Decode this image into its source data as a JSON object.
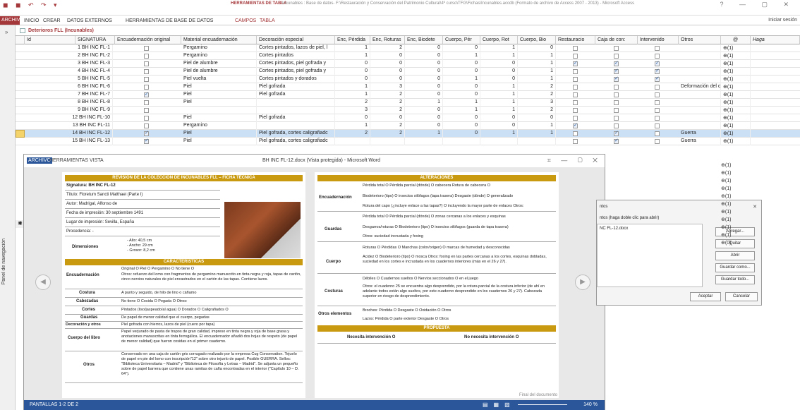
{
  "app": {
    "qat": "◼ ◼ ↶ ↷ ▾",
    "context_label": "HERRAMIENTAS DE TABLA",
    "title": "Incunables : Base de datos- F:\\Restauración y Conservación del Patrimonio Cultural\\4º curso\\TFG\\Fichas\\Incunables.accdb (Formato de archivo de Access 2007 - 2013) - Microsoft Access",
    "window_controls": "? — ▢ ✕",
    "signin": "Iniciar sesión"
  },
  "ribbon": {
    "archivo": "ARCHIVO",
    "tabs": [
      "INICIO",
      "CREAR",
      "DATOS EXTERNOS",
      "HERRAMIENTAS DE BASE DE DATOS",
      "CAMPOS",
      "TABLA"
    ]
  },
  "nav": {
    "label": "Panel de navegación",
    "toggle": "»"
  },
  "table": {
    "tab_label": "Deterioros FLL (Incunables)",
    "columns": [
      "Id",
      "SIGNATURA",
      "Encuadernación original",
      "Material encuadernación",
      "Decoración especial",
      "Enc, Pérdida",
      "Enc, Roturas",
      "Enc, Biodete",
      "Cuerpo, Pér",
      "Cuerpo, Rot",
      "Cuerpo, Bio",
      "Restauracio",
      "Caja de con:",
      "Intervenido",
      "Otros",
      "@",
      "Haga"
    ],
    "rows": [
      {
        "sig": "1 BH INC FL-1",
        "orig": false,
        "mat": "Pergamino",
        "dec": "Cortes pintados, lazos de piel, l",
        "ep": "1",
        "er": "2",
        "eb": "0",
        "cp": "0",
        "cr": "1",
        "cb": "0",
        "rest": false,
        "caja": false,
        "int": false,
        "otros": "",
        "att": "(1)"
      },
      {
        "sig": "2 BH INC FL-2",
        "orig": false,
        "mat": "Pergamino",
        "dec": "Cortes pintados",
        "ep": "1",
        "er": "0",
        "eb": "0",
        "cp": "1",
        "cr": "1",
        "cb": "1",
        "rest": false,
        "caja": false,
        "int": false,
        "otros": "",
        "att": "(1)"
      },
      {
        "sig": "3 BH INC FL-3",
        "orig": false,
        "mat": "Piel de alumbre",
        "dec": "Cortes pintados, piel gofrada y",
        "ep": "0",
        "er": "0",
        "eb": "0",
        "cp": "0",
        "cr": "0",
        "cb": "1",
        "rest": true,
        "caja": true,
        "int": true,
        "otros": "",
        "att": "(1)"
      },
      {
        "sig": "4 BH INC FL-4",
        "orig": false,
        "mat": "Piel de alumbre",
        "dec": "Cortes pintados, piel gofrada y",
        "ep": "0",
        "er": "0",
        "eb": "0",
        "cp": "0",
        "cr": "0",
        "cb": "1",
        "rest": false,
        "caja": true,
        "int": true,
        "otros": "",
        "att": "(1)"
      },
      {
        "sig": "5 BH INC FL-5",
        "orig": false,
        "mat": "Piel vuelta",
        "dec": "Cortes pintados y dorados",
        "ep": "0",
        "er": "0",
        "eb": "0",
        "cp": "1",
        "cr": "0",
        "cb": "1",
        "rest": false,
        "caja": true,
        "int": true,
        "otros": "",
        "att": "(1)"
      },
      {
        "sig": "6 BH INC FL-6",
        "orig": false,
        "mat": "Piel",
        "dec": "Piel gofrada",
        "ep": "1",
        "er": "3",
        "eb": "0",
        "cp": "0",
        "cr": "1",
        "cb": "2",
        "rest": false,
        "caja": false,
        "int": false,
        "otros": "Deformación del cu",
        "att": "(1)"
      },
      {
        "sig": "7 BH INC FL-7",
        "orig": true,
        "mat": "Piel",
        "dec": "Piel gofrada",
        "ep": "1",
        "er": "2",
        "eb": "0",
        "cp": "0",
        "cr": "1",
        "cb": "2",
        "rest": false,
        "caja": false,
        "int": false,
        "otros": "",
        "att": "(1)"
      },
      {
        "sig": "8 BH INC FL-8",
        "orig": false,
        "mat": "Piel",
        "dec": "",
        "ep": "2",
        "er": "2",
        "eb": "1",
        "cp": "1",
        "cr": "1",
        "cb": "3",
        "rest": false,
        "caja": false,
        "int": false,
        "otros": "",
        "att": "(1)"
      },
      {
        "sig": "9 BH INC FL-9",
        "orig": false,
        "mat": "",
        "dec": "",
        "ep": "3",
        "er": "2",
        "eb": "0",
        "cp": "1",
        "cr": "1",
        "cb": "2",
        "rest": false,
        "caja": false,
        "int": false,
        "otros": "",
        "att": "(1)"
      },
      {
        "sig": "12 BH INC FL-10",
        "orig": false,
        "mat": "Piel",
        "dec": "Piel gofrada",
        "ep": "0",
        "er": "0",
        "eb": "0",
        "cp": "0",
        "cr": "0",
        "cb": "0",
        "rest": false,
        "caja": false,
        "int": false,
        "otros": "",
        "att": "(1)"
      },
      {
        "sig": "13 BH INC FL-11",
        "orig": false,
        "mat": "Pergamino",
        "dec": "",
        "ep": "1",
        "er": "2",
        "eb": "0",
        "cp": "0",
        "cr": "0",
        "cb": "1",
        "rest": true,
        "caja": false,
        "int": false,
        "otros": "",
        "att": "(1)"
      },
      {
        "sig": "14 BH INC FL-12",
        "orig": true,
        "mat": "Piel",
        "dec": "Piel gofrada, cortes caligrafiadc",
        "ep": "2",
        "er": "2",
        "eb": "1",
        "cp": "0",
        "cr": "1",
        "cb": "1",
        "rest": false,
        "caja": true,
        "int": false,
        "otros": "Guerra",
        "att": "(1)"
      },
      {
        "sig": "15 BH INC FL-13",
        "orig": true,
        "mat": "Piel",
        "dec": "Piel gofrada, cortes caligrafiadc",
        "ep": "",
        "er": "",
        "eb": "",
        "cp": "",
        "cr": "",
        "cb": "",
        "rest": false,
        "caja": true,
        "int": false,
        "otros": "Guerra",
        "att": "(1)"
      }
    ],
    "extra_att": [
      "(1)",
      "(1)",
      "(1)",
      "(1)",
      "(1)",
      "(1)",
      "(1)",
      "(1)",
      "(1)",
      "(1)",
      "(0)"
    ]
  },
  "word": {
    "tabs": [
      "ARCHIVO",
      "HERRAMIENTAS",
      "VISTA"
    ],
    "title": "BH INC FL-12.docx (Vista protegida) - Microsoft Word",
    "controls": "⌗ — ▢ ✕",
    "status_screens": "PANTALLAS 1-2 DE 2",
    "zoom": "140 %",
    "end_doc": "Final del documento",
    "p1": {
      "title": "REVISIÓN DE LA COLECCIÓN DE INCUNABLES FLL – FICHA TÉCNICA",
      "signatura": "Signatura: BH INC FL-12",
      "titulo": "Título: Floretum Sancti Matthaei (Parte I)",
      "autor": "Autor: Madrigal, Alfonso de",
      "fecha": "Fecha de impresión: 30 septiembre 1491",
      "lugar": "Lugar de impresión: Sevilla, España",
      "procedencia": "Procedencia: -",
      "dim_label": "Dimensiones",
      "dim_vals": "- Alto: 40,5 cm\n- Ancho: 29 cm\n- Grosor: 8,2 cm",
      "carac": "CARACTERÍSTICAS",
      "enc_label": "Encuadernación",
      "enc_opts": "Original O        Piel O        Pergamino O        No tiene O",
      "enc_txt": "Otros: refuerzo del lomo con fragmentos de pergamino manuscrito en tinta negra y roja, tapas de cartón, cinco nervios naturales de piel encastrados en el cartón de las tapas. Contiene lazos.",
      "costura_label": "Costura",
      "costura_txt": "A punto y seguido, de hilo de lino o cáñamo",
      "cabezadas_label": "Cabezadas",
      "cabezadas_txt": "No tiene O        Cosida O        Pegada O        Otros:",
      "cortes_label": "Cortes",
      "cortes_txt": "Pintados (liso/jaspeado/al agua) O     Dorados O     Caligrafiados O",
      "guardas_label": "Guardas",
      "guardas_txt": "De papel de menor calidad que el cuerpo, pegadas",
      "deco_label": "Decoración y otros",
      "deco_txt": "Piel gofrada con hierros, lazos de piel (cuero por tapa)",
      "cuerpo_label": "Cuerpo del libro",
      "cuerpo_txt": "Papel verjurado de pasta de trapos de gran calidad, impreso en tinta negra y roja de base grasa y anotaciones manuscritas en tinta ferrogálica. El encuadernador añadió dos hojas de respeto (de papel de menor calidad) que fueron cosidas en el primer cuaderno.",
      "otros_label": "Otros",
      "otros_txt": "Conservado en una caja de cartón gris corrugado realizado por la empresa Cug Conservation. Tejuelo de papel en pie del lomo con inscripción\"12\" sobre otro tejuelo de papel. Posible GUERRA. Sellos: \"Biblioteca Universitaria – Madrid\" y \"Biblioteca de Filosofía y Letras – Madrid\". Se adjunta un pequeño sobre de papel barrera que contiene unas ramitas de caña encontradas en el interior (\"Capítulo 10 – D. 64\")."
    },
    "p2": {
      "title": "ALTERACIONES",
      "enc_label": "Encuadernación",
      "enc_l1": "Pérdida total O   Pérdida parcial (dónde) O cabecera   Rotura de cabecera O",
      "enc_l2": "Biodeterioro (tipo) O insectos xilófagos (tapa trasera)   Desgaste (dónde) O generalizado",
      "enc_l3": "Rotura del capo (¿incluye enlace a las tapas?) O incluyendo la mayor parte de enlaces Otros:",
      "guardas_label": "Guardas",
      "guardas_l1": "Pérdida total O   Pérdida parcial (dónde) O zonas cercanas a los enlaces y esquinas",
      "guardas_l2": "Desgarros/roturas O   Biodeterioro (tipo) O insectos xilófagos (guarda de tapa trasera)",
      "guardas_l3": "Otros: suciedad incrustada y foxing",
      "cuerpo_label": "Cuerpo",
      "cuerpo_l1": "Roturas O   Pérdidas O   Manchas (color/origen) O marcas de humedad y desconocidas",
      "cuerpo_l2": "Acidez O   Biodeterioro (tipo) O mosca   Otros: foxing en las partes cercanas a los cortes, esquinas dobladas, suciedad en los cortes e incrustada en los cuadernos interiores (más en el 26 y 27).",
      "costuras_label": "Costuras",
      "costuras_l1": "Débiles O        Cuadernos sueltos O        Nervios seccionados O en el juego",
      "costuras_l2": "Otros: el cuaderno 25 se encuentra algo desprendido, por la rotura parcial de la costura inferior (de ahí en adelante todos están algo sueltos, por este cuaderno desprendido en los cuadernos 26 y 27). Cabezada superior en riesgo de desprendimiento.",
      "otros_label": "Otros elementos",
      "otros_l1": "Broches:   Pérdida O   Desgaste O   Oxidación O   Otros",
      "otros_l2": "Lazos:   Pérdida O parte exterior   Desgaste O   Otros",
      "propuesta": "PROPUESTA",
      "si": "Necesita intervención O",
      "no": "No necesita intervención O"
    }
  },
  "dialog": {
    "close": "✕",
    "title": "ntos",
    "hint": "ntos (haga doble clic para abrir)",
    "file": "NC FL-12.docx",
    "buttons": [
      "Agregar...",
      "Quitar",
      "Abrir",
      "Guardar como...",
      "Guardar todo..."
    ],
    "ok": "Aceptar",
    "cancel": "Cancelar"
  }
}
